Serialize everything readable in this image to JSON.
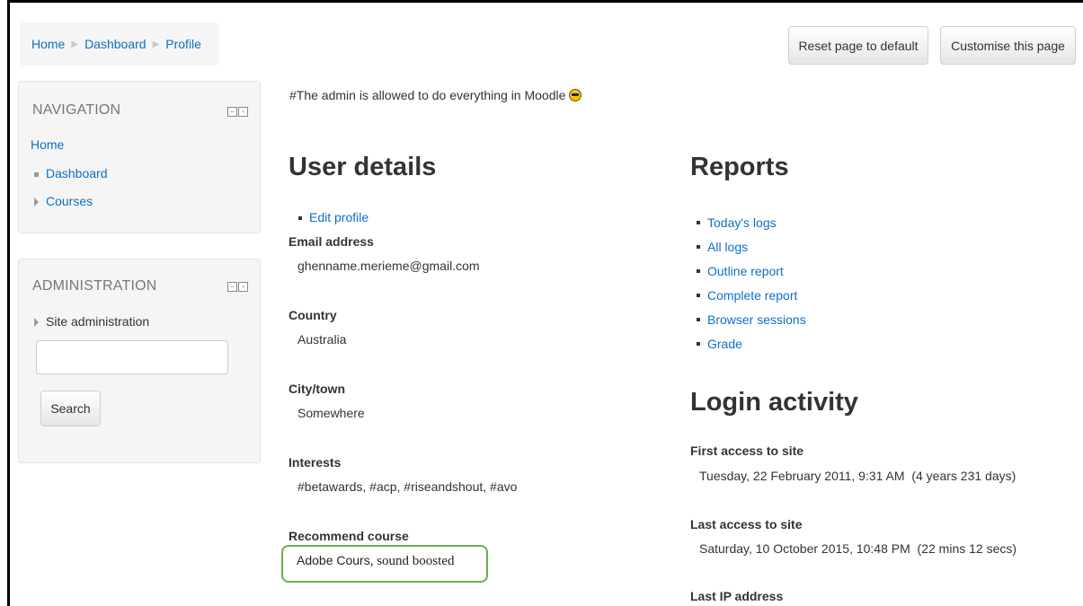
{
  "breadcrumb": {
    "items": [
      "Home",
      "Dashboard",
      "Profile"
    ]
  },
  "header": {
    "reset_label": "Reset page to default",
    "customise_label": "Customise this page"
  },
  "navigation": {
    "title": "NAVIGATION",
    "home": "Home",
    "dashboard": "Dashboard",
    "courses": "Courses"
  },
  "administration": {
    "title": "ADMINISTRATION",
    "site_admin": "Site administration",
    "search_value": "",
    "search_label": "Search"
  },
  "main": {
    "description": "#The admin is allowed to do everything in Moodle",
    "description_icon": "sunglasses-emoji-icon",
    "user_details": {
      "title": "User details",
      "edit_profile": "Edit profile",
      "email_label": "Email address",
      "email_value": "ghenname.merieme@gmail.com",
      "country_label": "Country",
      "country_value": "Australia",
      "city_label": "City/town",
      "city_value": "Somewhere",
      "interests_label": "Interests",
      "interests_value": "#betawards, #acp, #riseandshout, #avo",
      "recommend_label": "Recommend course",
      "recommend_value_a": "Adobe Cours",
      "recommend_value_b": ", sound boosted",
      "recommend_box_color": "#6ab04c"
    },
    "reports": {
      "title": "Reports",
      "items": [
        "Today's logs",
        "All logs",
        "Outline report",
        "Complete report",
        "Browser sessions",
        "Grade"
      ]
    },
    "login_activity": {
      "title": "Login activity",
      "first_label": "First access to site",
      "first_value": "Tuesday, 22 February 2011, 9:31 AM  (4 years 231 days)",
      "last_label": "Last access to site",
      "last_value": "Saturday, 10 October 2015, 10:48 PM  (22 mins 12 secs)",
      "ip_label": "Last IP address"
    }
  },
  "colors": {
    "link": "#0f6fc5",
    "block_bg": "#f5f5f5",
    "text": "#333333"
  }
}
